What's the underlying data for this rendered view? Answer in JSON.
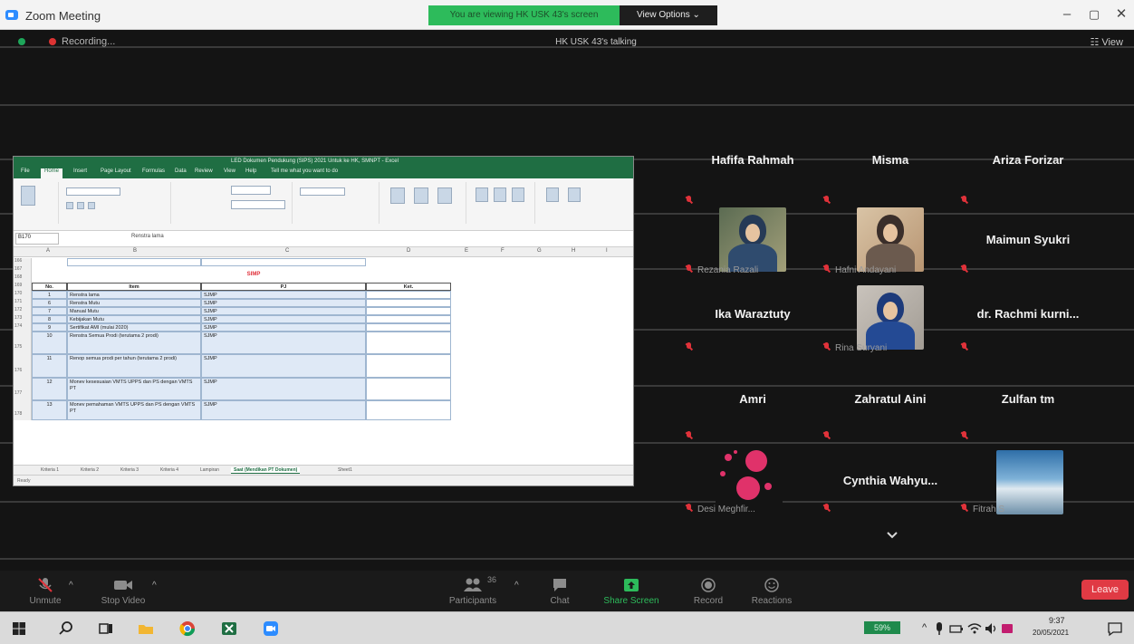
{
  "window": {
    "title": "Zoom Meeting",
    "share_banner": "You are viewing HK USK 43's screen",
    "view_options": "View Options ⌄",
    "minimize": "–",
    "maximize": "▢",
    "close": "✕"
  },
  "meeting": {
    "recording_label": "Recording...",
    "host_label": "HK USK 43's talking",
    "view_label": "☷ View"
  },
  "spreadsheet": {
    "title": "LED Dokumen Pendukung (SIPS) 2021 Untuk ke HK, SMNPT - Excel",
    "tabs": [
      "File",
      "Home",
      "Insert",
      "Page Layout",
      "Formulas",
      "Data",
      "Review",
      "View",
      "Help",
      "Tell me what you want to do"
    ],
    "namebox": "B170",
    "formula_value": "Renstra lama",
    "col_headers": [
      "A",
      "B",
      "C",
      "D",
      "E",
      "F",
      "G",
      "H",
      "I"
    ],
    "section_title": "SIMP",
    "headers": {
      "no": "No.",
      "item": "Item",
      "pj": "PJ",
      "ket": "Ket."
    },
    "row_numbers": [
      "166",
      "167",
      "168",
      "169",
      "170",
      "171",
      "172",
      "173",
      "174",
      "175",
      "176",
      "177",
      "178"
    ],
    "rows": [
      {
        "no": "1",
        "item": "Renstra lama",
        "pj": "SJMP"
      },
      {
        "no": "6",
        "item": "Renstra Mutu",
        "pj": "SJMP"
      },
      {
        "no": "7",
        "item": "Manual Mutu",
        "pj": "SJMP"
      },
      {
        "no": "8",
        "item": "Kebijakan Mutu",
        "pj": "SJMP"
      },
      {
        "no": "9",
        "item": "Sertifikat AMI (mulai 2020)",
        "pj": "SJMP"
      },
      {
        "no": "10",
        "item": "Renstra Semua Prodi (terutama 2 prodi)",
        "pj": "SJMP"
      },
      {
        "no": "11",
        "item": "Renop semua prodi per tahun (terutama 2 prodi)",
        "pj": "SJMP"
      },
      {
        "no": "12",
        "item": "Monev kesesuaian VMTS UPPS dan PS dengan VMTS PT",
        "pj": "SJMP"
      },
      {
        "no": "13",
        "item": "Monev pemahaman VMTS UPPS dan PS dengan VMTS PT",
        "pj": "SJMP"
      }
    ],
    "sheet_tabs": [
      "Kriteria 1",
      "Kriteria 2",
      "Kriteria 3",
      "Kriteria 4",
      "Lampiran",
      "Saat (Mendikan PT Dokumen)",
      "Sheet1"
    ],
    "status": "Ready"
  },
  "participants": [
    {
      "name": "Hafifa Rahmah",
      "kind": "name"
    },
    {
      "name": "Misma",
      "kind": "name"
    },
    {
      "name": "Ariza Forizar",
      "kind": "name"
    },
    {
      "name": "Rezania Razali",
      "kind": "video"
    },
    {
      "name": "Hafni Andayani",
      "kind": "video"
    },
    {
      "name": "Maimun Syukri",
      "kind": "name"
    },
    {
      "name": "Ika Waraztuty",
      "kind": "name"
    },
    {
      "name": "Rina Suryani",
      "kind": "video"
    },
    {
      "name": "dr. Rachmi kurni...",
      "kind": "name"
    },
    {
      "name": "Amri",
      "kind": "name"
    },
    {
      "name": "Zahratul Aini",
      "kind": "name"
    },
    {
      "name": "Zulfan tm",
      "kind": "name"
    },
    {
      "name": "Desi Meghfir...",
      "kind": "video"
    },
    {
      "name": "Cynthia Wahyu...",
      "kind": "name"
    },
    {
      "name": "Fitrah S",
      "kind": "video"
    }
  ],
  "toolbar": {
    "unmute": "Unmute",
    "stop_video": "Stop Video",
    "participants": "Participants",
    "participant_count": "36",
    "chat": "Chat",
    "share_screen": "Share Screen",
    "record": "Record",
    "reactions": "Reactions",
    "leave": "Leave"
  },
  "taskbar": {
    "battery": "59%",
    "time": "9:37",
    "date": "20/05/2021"
  },
  "colors": {
    "zoom_blue": "#2d8cff",
    "share_green": "#2dbb5b",
    "leave_red": "#e03a44",
    "excel_green": "#1f6e43",
    "mute_red": "#e0323a"
  }
}
